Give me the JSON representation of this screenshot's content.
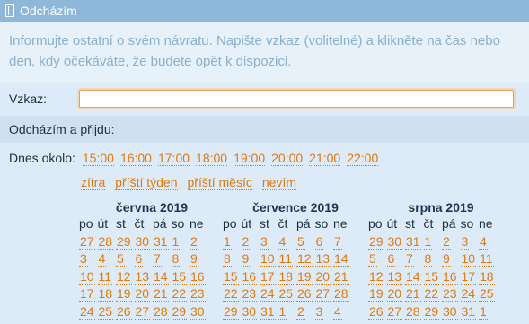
{
  "title": "Odcházím",
  "info_text": "Informujte ostatní o svém návratu. Napište vzkaz (volitelné) a klikněte na čas nebo den, kdy očekáváte, že budete opět k dispozici.",
  "message": {
    "label": "Vzkaz:",
    "value": ""
  },
  "return_header": "Odcházím a přijdu:",
  "today": {
    "label": "Dnes okolo:",
    "times": [
      "15:00",
      "16:00",
      "17:00",
      "18:00",
      "19:00",
      "20:00",
      "21:00",
      "22:00"
    ]
  },
  "quick_links": [
    "zítra",
    "příští týden",
    "příští měsíc",
    "nevím"
  ],
  "weekdays": [
    "po",
    "út",
    "st",
    "čt",
    "pá",
    "so",
    "ne"
  ],
  "calendars": [
    {
      "month": "června 2019",
      "days": [
        "27",
        "28",
        "29",
        "30",
        "31",
        "1",
        "2",
        "3",
        "4",
        "5",
        "6",
        "7",
        "8",
        "9",
        "10",
        "11",
        "12",
        "13",
        "14",
        "15",
        "16",
        "17",
        "18",
        "19",
        "20",
        "21",
        "22",
        "23",
        "24",
        "25",
        "26",
        "27",
        "28",
        "29",
        "30"
      ]
    },
    {
      "month": "července 2019",
      "days": [
        "1",
        "2",
        "3",
        "4",
        "5",
        "6",
        "7",
        "8",
        "9",
        "10",
        "11",
        "12",
        "13",
        "14",
        "15",
        "16",
        "17",
        "18",
        "19",
        "20",
        "21",
        "22",
        "23",
        "24",
        "25",
        "26",
        "27",
        "28",
        "29",
        "30",
        "31",
        "1",
        "2",
        "3",
        "4"
      ]
    },
    {
      "month": "srpna 2019",
      "days": [
        "29",
        "30",
        "31",
        "1",
        "2",
        "3",
        "4",
        "5",
        "6",
        "7",
        "8",
        "9",
        "10",
        "11",
        "12",
        "13",
        "14",
        "15",
        "16",
        "17",
        "18",
        "19",
        "20",
        "21",
        "22",
        "23",
        "24",
        "25",
        "26",
        "27",
        "28",
        "29",
        "30",
        "31",
        "1"
      ]
    }
  ],
  "colors": {
    "link": "#e07a10",
    "titlebar": "#8eb8d9",
    "background": "#dcebf7"
  }
}
